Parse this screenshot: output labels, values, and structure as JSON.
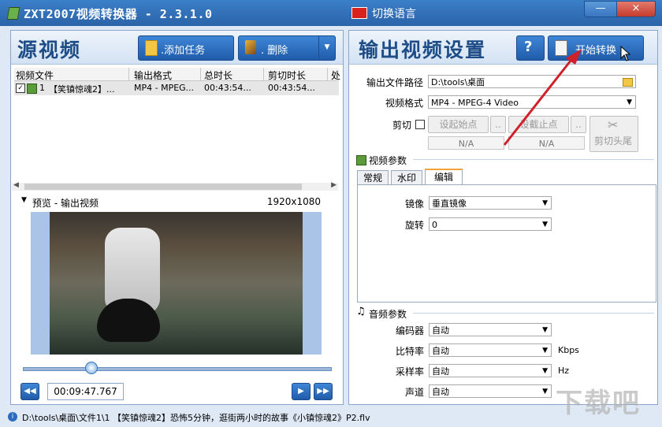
{
  "app": {
    "title": "ZXT2007视频转换器 - 2.3.1.0",
    "language_button": "切换语言",
    "minimize": "—",
    "close": "×"
  },
  "source": {
    "title": "源视频",
    "add_task": ".添加任务",
    "delete": ".    删除",
    "columns": [
      "视频文件",
      "输出格式",
      "总时长",
      "剪切时长",
      "处"
    ],
    "rows": [
      {
        "index": "1",
        "name": "【笑镇惊魂2】...",
        "format": "MP4 - MPEG...",
        "duration": "00:43:54...",
        "cut": "00:43:54..."
      }
    ]
  },
  "preview": {
    "label": "预览 - 输出视频",
    "resolution": "1920x1080",
    "time": "00:09:47.767",
    "progress": 0.22
  },
  "output": {
    "title": "输出视频设置",
    "help": "?",
    "start": "开始转换",
    "path_label": "输出文件路径",
    "path_value": "D:\\tools\\桌面",
    "format_label": "视频格式",
    "format_value": "MP4 - MPEG-4 Video",
    "cut_label": "剪切",
    "set_start": "设起始点",
    "set_end": "设截止点",
    "dots": "..",
    "start_value": "N/A",
    "end_value": "N/A",
    "cut_head_tail": "剪切头尾",
    "video_params": "视频参数",
    "tabs": [
      "常规",
      "水印",
      "编辑"
    ],
    "mirror_label": "镜像",
    "mirror_value": "垂直镜像",
    "rotate_label": "旋转",
    "rotate_value": "0",
    "audio_params": "音频参数",
    "encoder_label": "编码器",
    "encoder_value": "自动",
    "bitrate_label": "比特率",
    "bitrate_value": "自动",
    "bitrate_unit": "Kbps",
    "samplerate_label": "采样率",
    "samplerate_value": "自动",
    "samplerate_unit": "Hz",
    "channel_label": "声道",
    "channel_value": "自动"
  },
  "status": {
    "path": "D:\\tools\\桌面\\文件1\\1 【笑镇惊魂2】恐怖5分钟，逛街两小时的故事《小镇惊魂2》P2.flv"
  },
  "watermark": "下载吧",
  "colors": {
    "title_bar": "#2a63a8",
    "accent": "#1f5caa",
    "arrow": "#d0202a"
  }
}
